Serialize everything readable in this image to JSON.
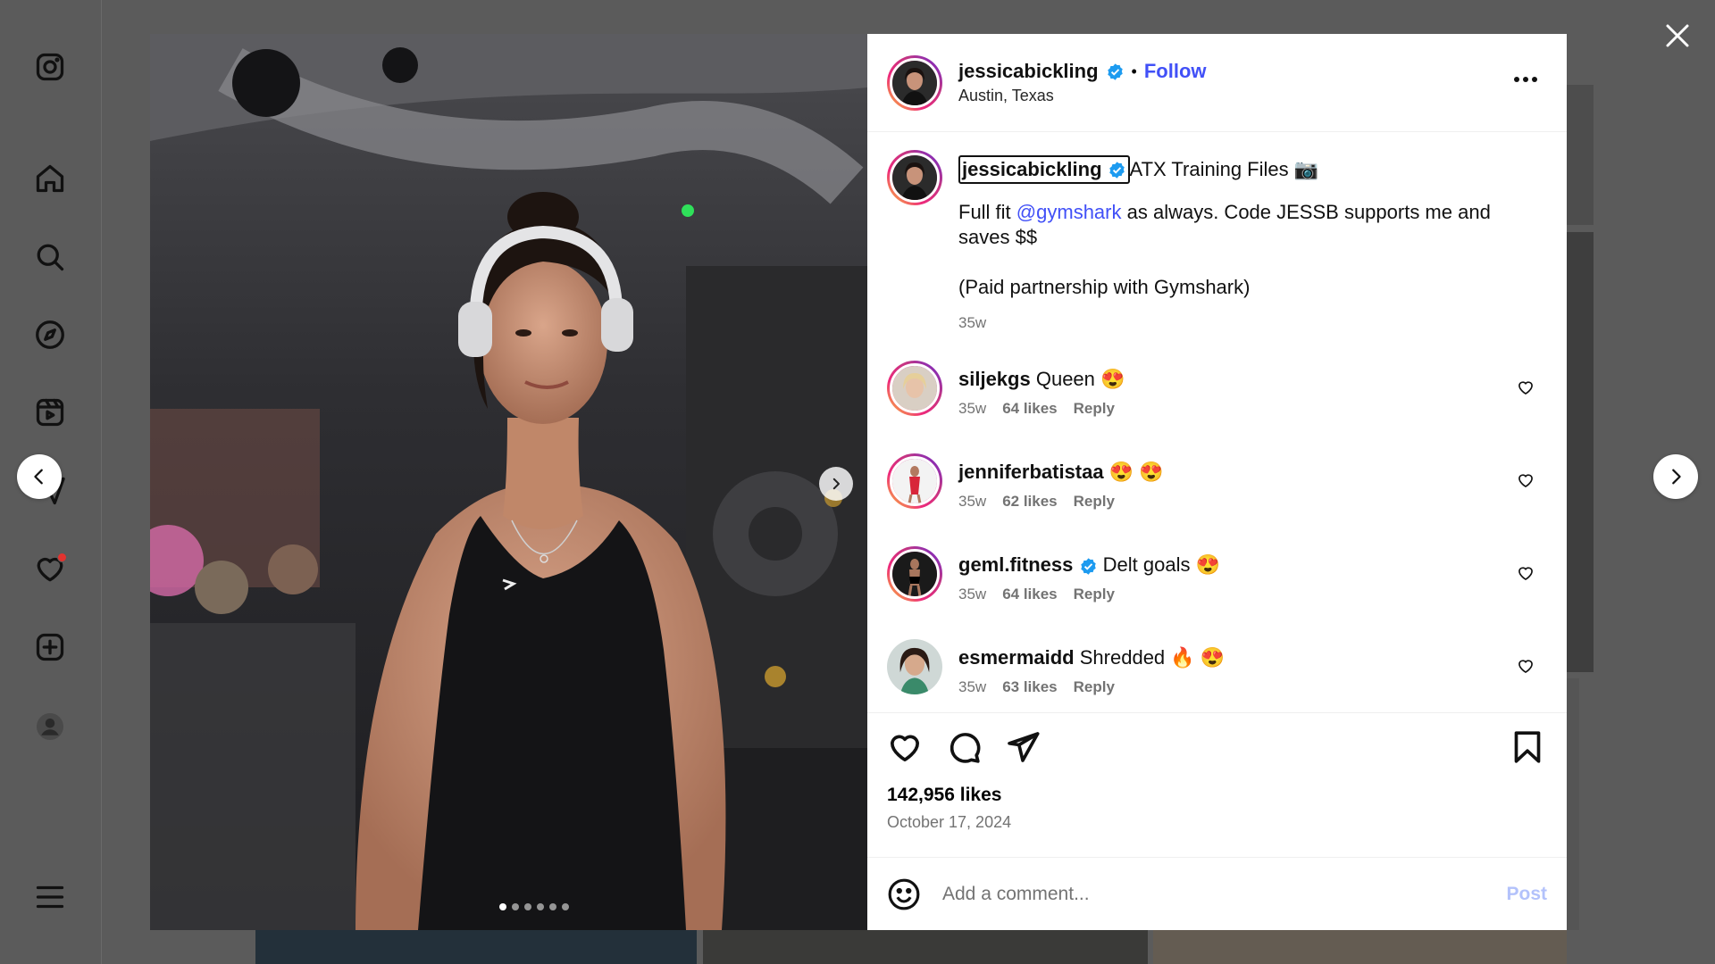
{
  "post": {
    "username": "jessicabickling",
    "follow_label": "Follow",
    "separator": "•",
    "location": "Austin, Texas",
    "caption_title": "ATX Training Files 📷",
    "caption_line1_prefix": "Full fit ",
    "caption_mention": "@gymshark",
    "caption_line1_suffix": " as always. Code JESSB supports me and saves $$",
    "caption_line2": "(Paid partnership with Gymshark)",
    "caption_time": "35w",
    "likes": "142,956 likes",
    "date": "October 17, 2024",
    "media_total": 6,
    "media_active": 1
  },
  "comments": [
    {
      "user": "siljekgs",
      "verified": false,
      "text": "Queen 😍",
      "time": "35w",
      "likes": "64 likes",
      "reply": "Reply"
    },
    {
      "user": "jenniferbatistaa",
      "verified": false,
      "text": "😍 😍",
      "time": "35w",
      "likes": "62 likes",
      "reply": "Reply"
    },
    {
      "user": "geml.fitness",
      "verified": true,
      "text": "Delt goals 😍",
      "time": "35w",
      "likes": "64 likes",
      "reply": "Reply"
    },
    {
      "user": "esmermaidd",
      "verified": false,
      "text": "Shredded 🔥 😍",
      "time": "35w",
      "likes": "63 likes",
      "reply": "Reply"
    }
  ],
  "comment_box": {
    "placeholder": "Add a comment...",
    "post_label": "Post"
  },
  "icons": {
    "sidebar": [
      "instagram-icon",
      "home-icon",
      "search-icon",
      "explore-icon",
      "reels-icon",
      "messages-icon",
      "heart-icon",
      "create-icon",
      "profile-icon",
      "menu-icon"
    ]
  },
  "colors": {
    "accent": "#4150f7",
    "verified": "#1d9bf0",
    "post_disabled": "#b3c2fb",
    "notification": "#e3332f"
  }
}
